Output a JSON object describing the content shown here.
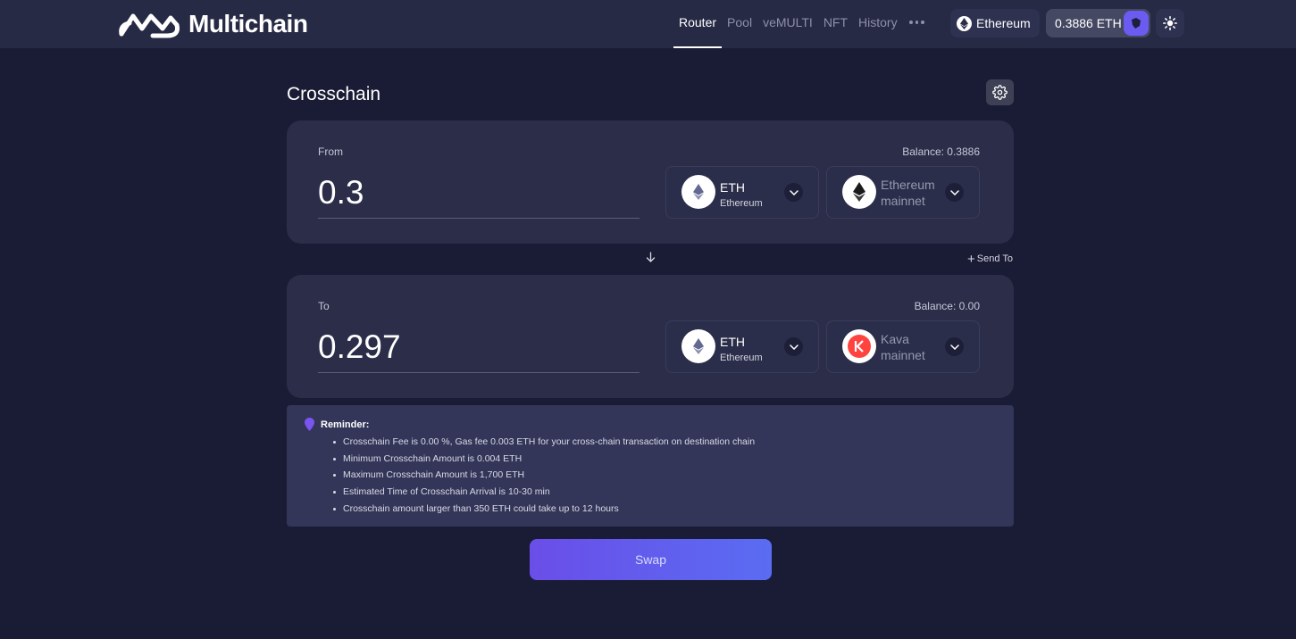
{
  "header": {
    "logo_text": "Multichain",
    "nav": [
      {
        "label": "Router",
        "active": true
      },
      {
        "label": "Pool",
        "active": false
      },
      {
        "label": "veMULTI",
        "active": false
      },
      {
        "label": "NFT",
        "active": false
      },
      {
        "label": "History",
        "active": false
      }
    ],
    "more_icon": "ellipsis-icon",
    "network_label": "Ethereum",
    "balance_label": "0.3886 ETH",
    "theme_icon": "sun-icon"
  },
  "page": {
    "title": "Crosschain",
    "settings_icon": "gear-icon"
  },
  "from": {
    "label": "From",
    "balance": "Balance: 0.3886",
    "amount": "0.3",
    "token_symbol": "ETH",
    "token_network": "Ethereum",
    "chain_name": "Ethereum mainnet"
  },
  "to": {
    "label": "To",
    "balance": "Balance: 0.00",
    "amount": "0.297",
    "token_symbol": "ETH",
    "token_network": "Ethereum",
    "chain_name": "Kava mainnet"
  },
  "send_to": "Send To",
  "reminder": {
    "title": "Reminder:",
    "items": [
      "Crosschain Fee is 0.00 %, Gas fee 0.003 ETH for your cross-chain transaction on destination chain",
      "Minimum Crosschain Amount is 0.004 ETH",
      "Maximum Crosschain Amount is 1,700 ETH",
      "Estimated Time of Crosschain Arrival is 10-30 min",
      "Crosschain amount larger than 350 ETH could take up to 12 hours"
    ]
  },
  "swap_label": "Swap",
  "colors": {
    "background": "#1a1b35",
    "panel": "#2b2d49",
    "accent_start": "#6a4ee8",
    "accent_end": "#5a6cf2",
    "kava_red": "#ff433e"
  }
}
